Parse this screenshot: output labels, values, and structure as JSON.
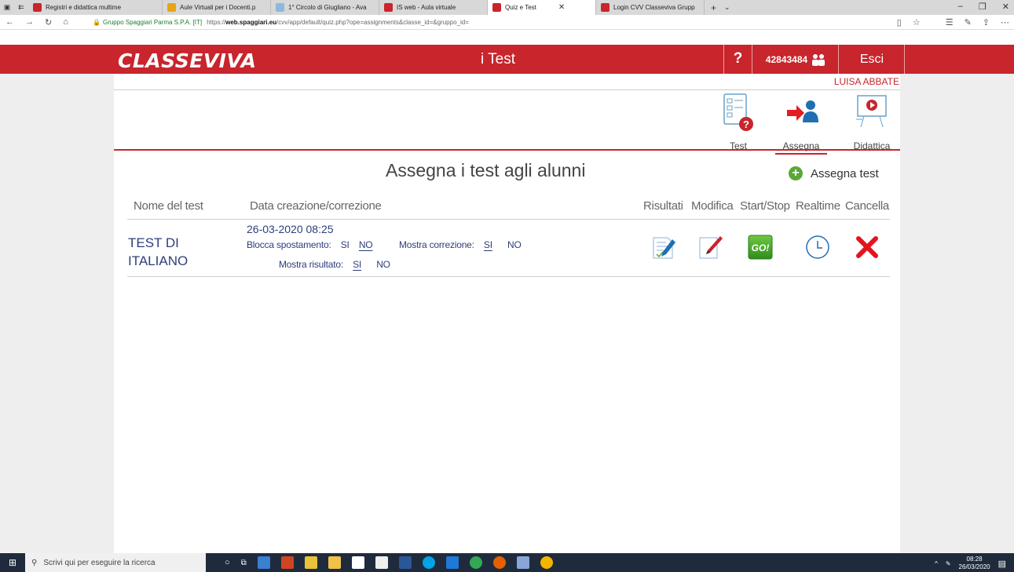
{
  "browser": {
    "tabs": [
      {
        "label": "Registri e didattica multime",
        "icon": "classeviva-favicon"
      },
      {
        "label": "Aule Virtuali per i Docenti.p",
        "icon": "document-favicon"
      },
      {
        "label": "1° Circolo di Giugliano - Ava",
        "icon": "school-favicon"
      },
      {
        "label": "IS web - Aula virtuale",
        "icon": "classeviva-favicon"
      },
      {
        "label": "Quiz e Test",
        "icon": "classeviva-favicon"
      },
      {
        "label": "Login CVV Classeviva Grupp",
        "icon": "classeviva-favicon"
      }
    ],
    "site_identity": "Gruppo Spaggiari Parma S.P.A. [IT]",
    "url_prefix": "https://",
    "url_domain": "web.spaggiari.eu",
    "url_path": "/cvv/app/default/quiz.php?ope=assignments&classe_id=&gruppo_id="
  },
  "header": {
    "logo": "CLASSEVIVA",
    "title": "i Test",
    "help": "?",
    "user_id": "42843484",
    "logout": "Esci",
    "username": "LUISA ABBATE"
  },
  "iconnav": {
    "test": "Test",
    "assegna": "Assegna",
    "didattica": "Didattica"
  },
  "main": {
    "heading": "Assegna i test agli alunni",
    "add_button": "Assegna test",
    "columns": {
      "nome": "Nome del test",
      "data": "Data creazione/correzione",
      "risultati": "Risultati",
      "modifica": "Modifica",
      "startstop": "Start/Stop",
      "realtime": "Realtime",
      "cancella": "Cancella"
    },
    "rows": [
      {
        "name": "TEST DI ITALIANO",
        "date": "26-03-2020 08:25",
        "blocca_label": "Blocca spostamento:",
        "blocca_si": "SI",
        "blocca_no": "NO",
        "correzione_label": "Mostra correzione:",
        "correzione_si": "SI",
        "correzione_no": "NO",
        "risultato_label": "Mostra risultato:",
        "risultato_si": "SI",
        "risultato_no": "NO",
        "go_label": "GO!"
      }
    ]
  },
  "taskbar": {
    "search_placeholder": "Scrivi qui per eseguire la ricerca",
    "time": "08:28",
    "date": "26/03/2020"
  },
  "colors": {
    "brand_red": "#c8252c",
    "link_blue": "#2f3e7c",
    "add_green": "#5aa836"
  }
}
